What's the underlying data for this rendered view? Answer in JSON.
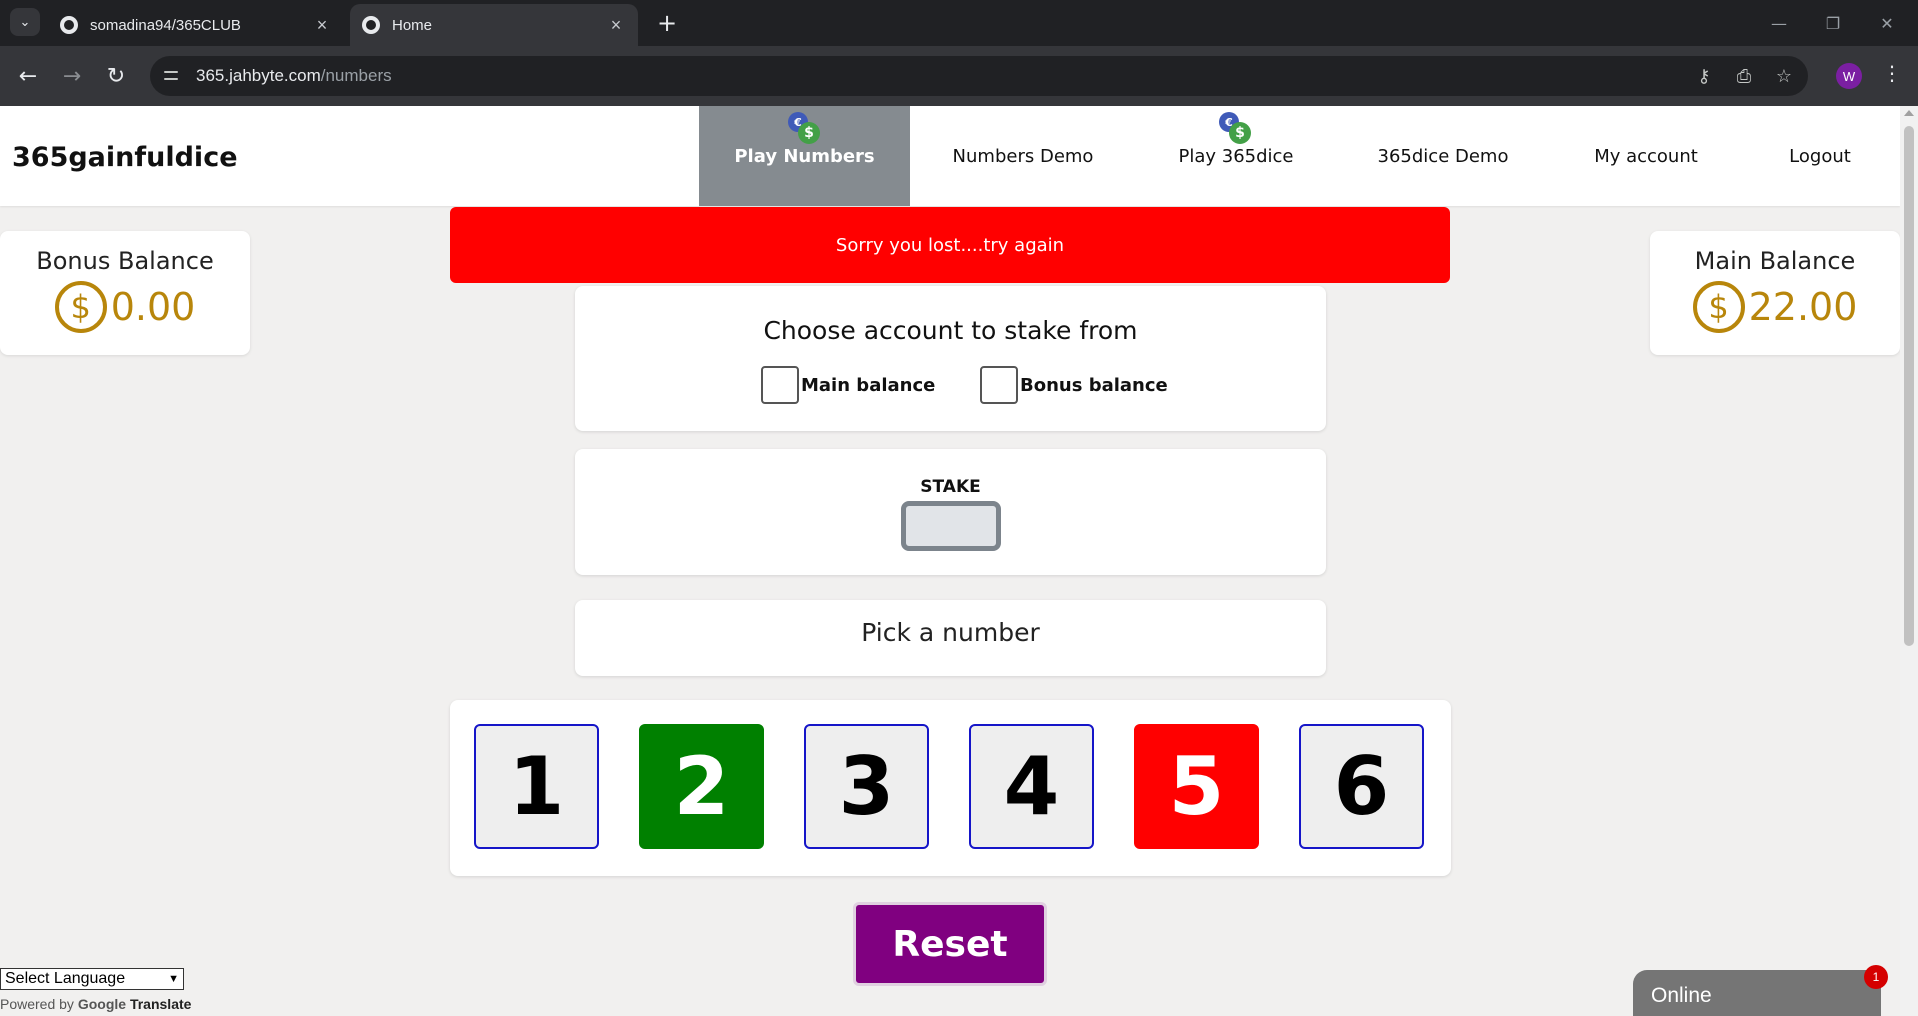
{
  "browser": {
    "tabs": [
      {
        "title": "somadina94/365CLUB",
        "active": false
      },
      {
        "title": "Home",
        "active": true
      }
    ],
    "url_host": "365.jahbyte.com",
    "url_path": "/numbers",
    "profile_initial": "W"
  },
  "header": {
    "brand": "365gainfuldice",
    "nav": [
      {
        "label": "Play Numbers",
        "active": true,
        "icon": "coin-dollar-icon"
      },
      {
        "label": "Numbers Demo",
        "active": false
      },
      {
        "label": "Play 365dice",
        "active": false,
        "icon": "coin-dollar-icon"
      },
      {
        "label": "365dice Demo",
        "active": false
      },
      {
        "label": "My account",
        "active": false
      },
      {
        "label": "Logout",
        "active": false
      }
    ]
  },
  "alert": {
    "message": "Sorry you lost....try again",
    "color": "#ff0000"
  },
  "balances": {
    "bonus": {
      "title": "Bonus Balance",
      "amount": "0.00",
      "symbol": "$"
    },
    "main": {
      "title": "Main Balance",
      "amount": "22.00",
      "symbol": "$"
    }
  },
  "stake_from": {
    "title": "Choose account to stake from",
    "options": [
      "Main balance",
      "Bonus balance"
    ]
  },
  "stake": {
    "label": "STAKE",
    "value": ""
  },
  "pick": {
    "label": "Pick a number"
  },
  "dice": [
    {
      "value": "1",
      "state": "default"
    },
    {
      "value": "2",
      "state": "picked"
    },
    {
      "value": "3",
      "state": "default"
    },
    {
      "value": "4",
      "state": "default"
    },
    {
      "value": "5",
      "state": "result"
    },
    {
      "value": "6",
      "state": "default"
    }
  ],
  "reset_label": "Reset",
  "translate": {
    "select_label": "Select Language",
    "powered_by": "Powered by",
    "google": "Google",
    "translate": "Translate"
  },
  "chat": {
    "label": "Online",
    "badge": "1"
  },
  "colors": {
    "accent": "#800080",
    "win": "#008000",
    "lose": "#ff0000",
    "gold": "#b8860b"
  }
}
